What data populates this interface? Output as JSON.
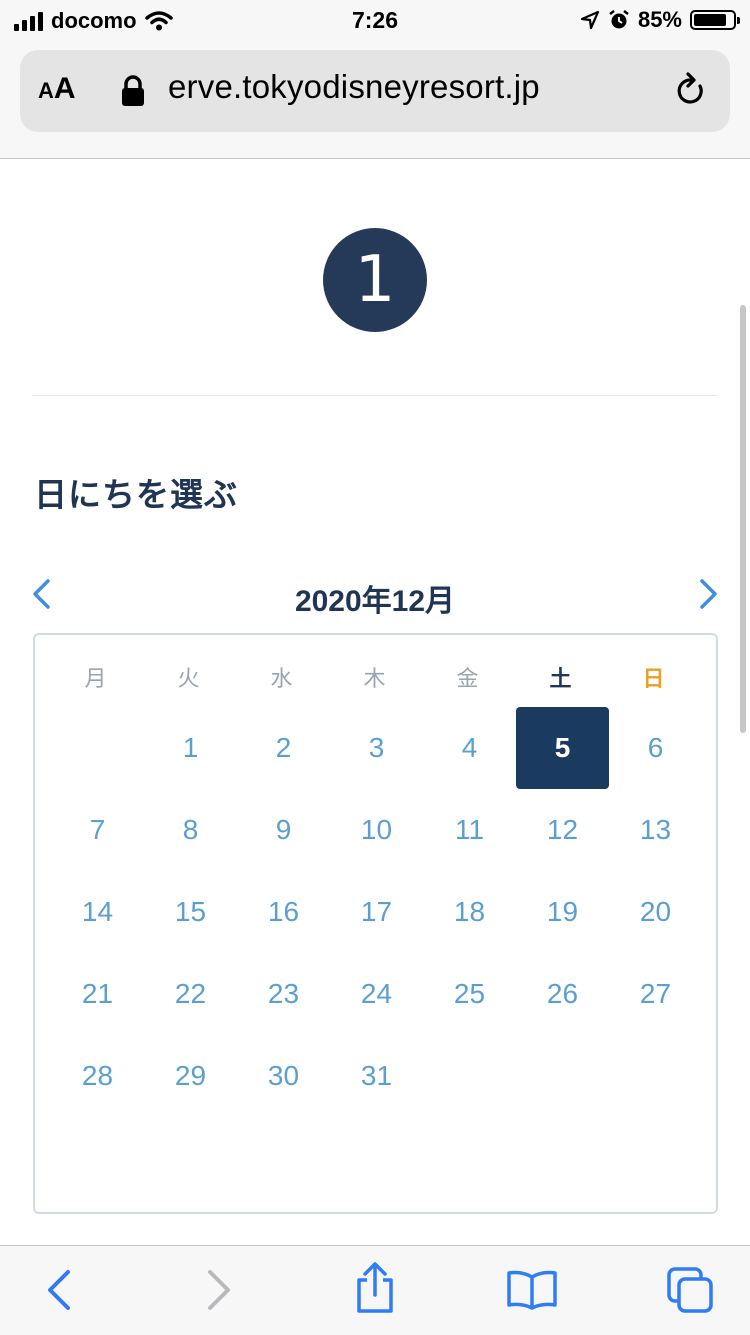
{
  "status_bar": {
    "carrier": "docomo",
    "time": "7:26",
    "battery": "85%",
    "battery_level": 0.85
  },
  "browser": {
    "text_size_label": "AA",
    "url": "erve.tokyodisneyresort.jp"
  },
  "page": {
    "step_number": "1",
    "section_title": "日にちを選ぶ"
  },
  "calendar": {
    "month_label": "2020年12月",
    "weekdays": [
      "月",
      "火",
      "水",
      "木",
      "金",
      "土",
      "日"
    ],
    "weeks": [
      [
        "",
        "1",
        "2",
        "3",
        "4",
        "5",
        "6"
      ],
      [
        "7",
        "8",
        "9",
        "10",
        "11",
        "12",
        "13"
      ],
      [
        "14",
        "15",
        "16",
        "17",
        "18",
        "19",
        "20"
      ],
      [
        "21",
        "22",
        "23",
        "24",
        "25",
        "26",
        "27"
      ],
      [
        "28",
        "29",
        "30",
        "31",
        "",
        "",
        ""
      ]
    ],
    "selected_day": "5"
  },
  "colors": {
    "navy": "#243a58",
    "selected": "#1b3a60",
    "day_text": "#5b9fd2",
    "sunday": "#e9a21f",
    "toolbar_blue": "#2e7cf6"
  }
}
